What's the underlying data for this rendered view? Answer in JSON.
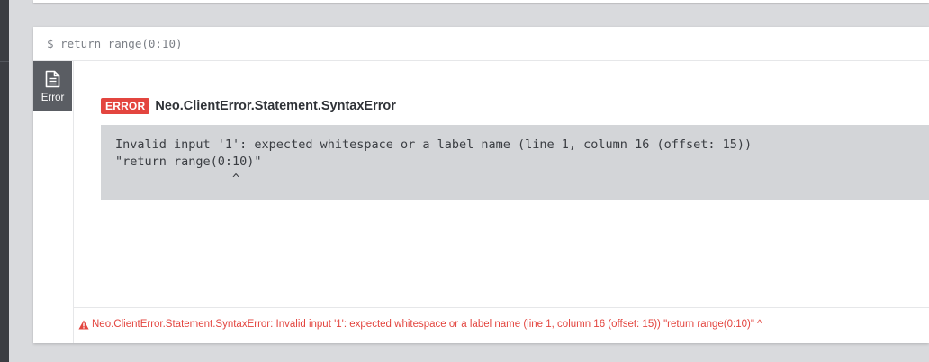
{
  "frame": {
    "command": "$ return range(0:10)",
    "side_tab_label": "Error"
  },
  "error": {
    "badge": "ERROR",
    "title": "Neo.ClientError.Statement.SyntaxError",
    "body": "Invalid input '1': expected whitespace or a label name (line 1, column 16 (offset: 15))\n\"return range(0:10)\"\n                ^"
  },
  "status": {
    "message": "Neo.ClientError.Statement.SyntaxError: Invalid input '1': expected whitespace or a label name (line 1, column 16 (offset: 15)) \"return range(0:10)\" ^"
  },
  "colors": {
    "error_red": "#e3453f",
    "tab_gray": "#5a5d63",
    "code_bg": "#d3d5d8",
    "page_bg": "#d9dadd"
  },
  "icons": {
    "side_tab": "document-icon",
    "status": "warning-triangle-icon"
  }
}
